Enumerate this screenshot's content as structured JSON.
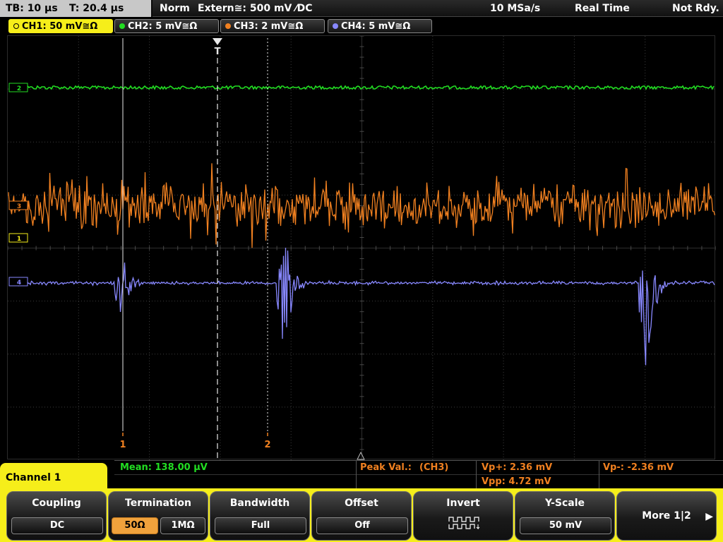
{
  "status_bar": {
    "timebase": "TB: 10 µs",
    "trigger_time": "T: 20.4 µs",
    "acquisition_mode": "Norm",
    "trigger_source": "Extern≅: 500 mV ⁄DC",
    "sample_rate": "10 MSa/s",
    "acquisition_type": "Real Time",
    "trigger_state": "Not Rdy."
  },
  "channels": [
    {
      "label": "CH1: 50 mV≅Ω",
      "color": "#f6ee1a",
      "active": true
    },
    {
      "label": "CH2: 5 mV≅Ω",
      "color": "#22dd22",
      "active": false
    },
    {
      "label": "CH3: 2 mV≅Ω",
      "color": "#f08020",
      "active": false
    },
    {
      "label": "CH4: 5 mV≅Ω",
      "color": "#8888ff",
      "active": false
    }
  ],
  "screen": {
    "ref_markers": {
      "ch2": "2",
      "ch3": "3",
      "ch1": "1",
      "ch4": "4"
    },
    "trigger_marker": "T",
    "cursor_1_label": "1",
    "cursor_2_label": "2"
  },
  "measurements": {
    "mean": "Mean: 138.00 µV",
    "peak_title": "Peak Val.:",
    "peak_source": "(CH3)",
    "vp_plus": "Vp+: 2.36 mV",
    "vp_minus": "Vp-: -2.36 mV",
    "vpp": "Vpp: 4.72 mV"
  },
  "menu": {
    "title": "Channel 1",
    "softkeys": {
      "coupling": {
        "label": "Coupling",
        "value": "DC"
      },
      "termination": {
        "label": "Termination",
        "option_a": "50Ω",
        "option_b": "1MΩ",
        "selected": "50Ω"
      },
      "bandwidth": {
        "label": "Bandwidth",
        "value": "Full"
      },
      "offset": {
        "label": "Offset",
        "value": "Off"
      },
      "invert": {
        "label": "Invert",
        "icon": "invert-waveform-icon"
      },
      "yscale": {
        "label": "Y-Scale",
        "value": "50 mV"
      },
      "more": {
        "label": "More 1|2",
        "icon": "arrow-right-icon"
      }
    }
  },
  "colors": {
    "ch1": "#f6ee1a",
    "ch2": "#22dd22",
    "ch3": "#f08020",
    "ch4": "#8888ff",
    "menu_bg": "#f6ee1a",
    "selected_option": "#f0a23c"
  }
}
